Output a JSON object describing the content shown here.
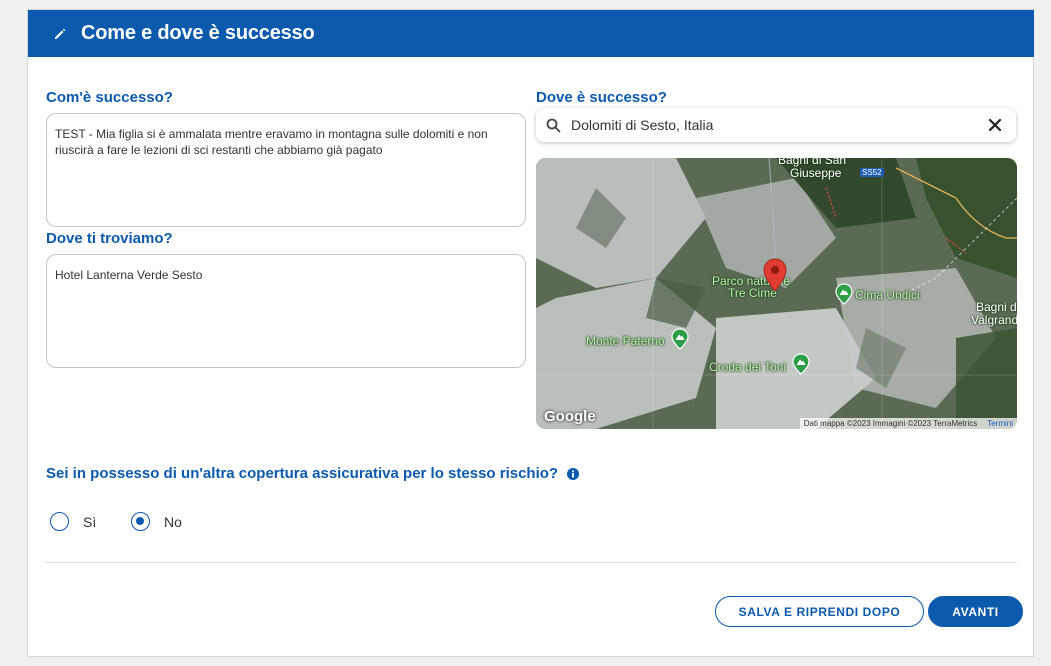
{
  "section": {
    "title": "Come e dove è successo"
  },
  "how": {
    "label": "Com'è successo?",
    "value": "TEST - Mia figlia si è ammalata mentre eravamo in montagna sulle dolomiti e non riuscirà a fare le lezioni di sci restanti che abbiamo già pagato"
  },
  "where": {
    "label": "Dove è successo?",
    "search_value": "Dolomiti di Sesto, Italia"
  },
  "find_you": {
    "label": "Dove ti troviamo?",
    "value": "Hotel Lanterna Verde Sesto"
  },
  "map": {
    "labels": {
      "bagni_san_giuseppe_1": "Bagni di San",
      "bagni_san_giuseppe_2": "Giuseppe",
      "road": "SS52",
      "parco_1": "Parco naturale",
      "parco_2": "Tre Cime",
      "cima_undici": "Cima Undici",
      "bagni_valgrande_1": "Bagni di",
      "bagni_valgrande_2": "Valgrande",
      "monte_paterno": "Monte Paterno",
      "croda_toni": "Croda dei Toni"
    },
    "logo": "Google",
    "attribution": "Dati mappa ©2023 Immagini ©2023 TerraMetrics",
    "terms": "Termini"
  },
  "coverage": {
    "question": "Sei in possesso di un'altra copertura assicurativa per lo stesso rischio?",
    "options": [
      {
        "label": "Sì",
        "checked": false
      },
      {
        "label": "No",
        "checked": true
      }
    ]
  },
  "actions": {
    "save_later": "SALVA E RIPRENDI DOPO",
    "next": "AVANTI"
  },
  "colors": {
    "brand": "#0b5aae",
    "marker": "#e03c31",
    "poi": "#2e9e45"
  }
}
